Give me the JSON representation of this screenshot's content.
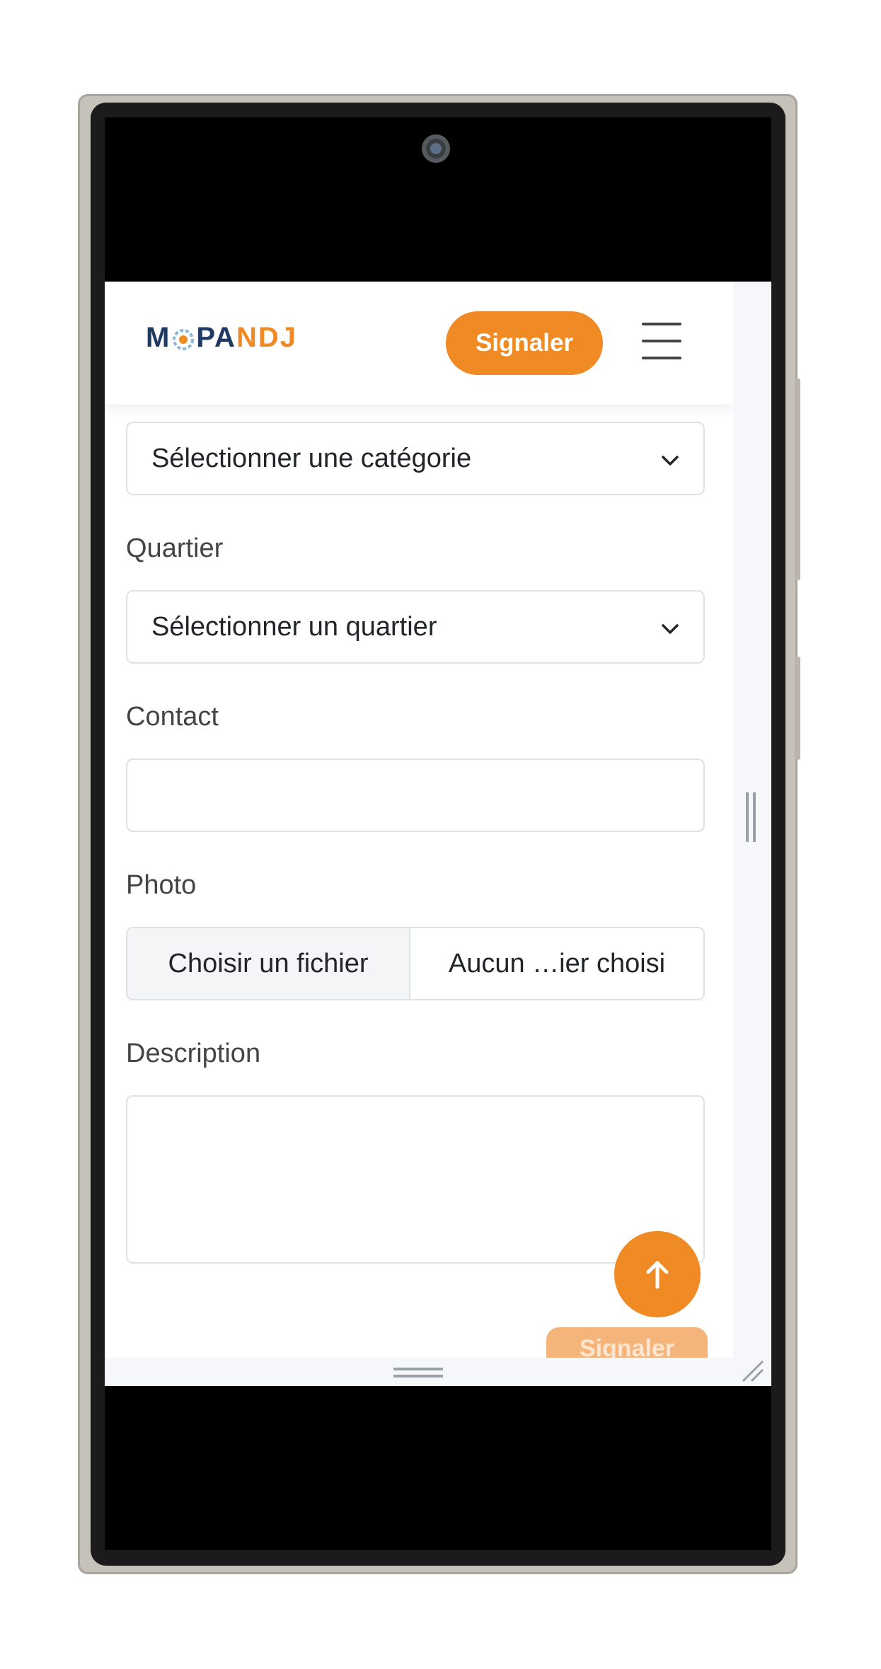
{
  "navbar": {
    "logo": {
      "part1": "M",
      "part2": "PA",
      "part3": "NDJ"
    },
    "signal_label": "Signaler",
    "menu_icon": "hamburger-menu-icon"
  },
  "form": {
    "category": {
      "value": "Sélectionner une catégorie"
    },
    "district": {
      "label": "Quartier",
      "value": "Sélectionner un quartier"
    },
    "contact": {
      "label": "Contact",
      "value": ""
    },
    "photo": {
      "label": "Photo",
      "button": "Choisir un fichier",
      "filename": "Aucun …ier choisi"
    },
    "description": {
      "label": "Description",
      "value": ""
    },
    "submit_label": "Signaler"
  },
  "scroll_top_icon": "arrow-up-icon",
  "colors": {
    "accent": "#f08a24",
    "brand_navy": "#1f3b64",
    "border": "#dee2e6"
  }
}
